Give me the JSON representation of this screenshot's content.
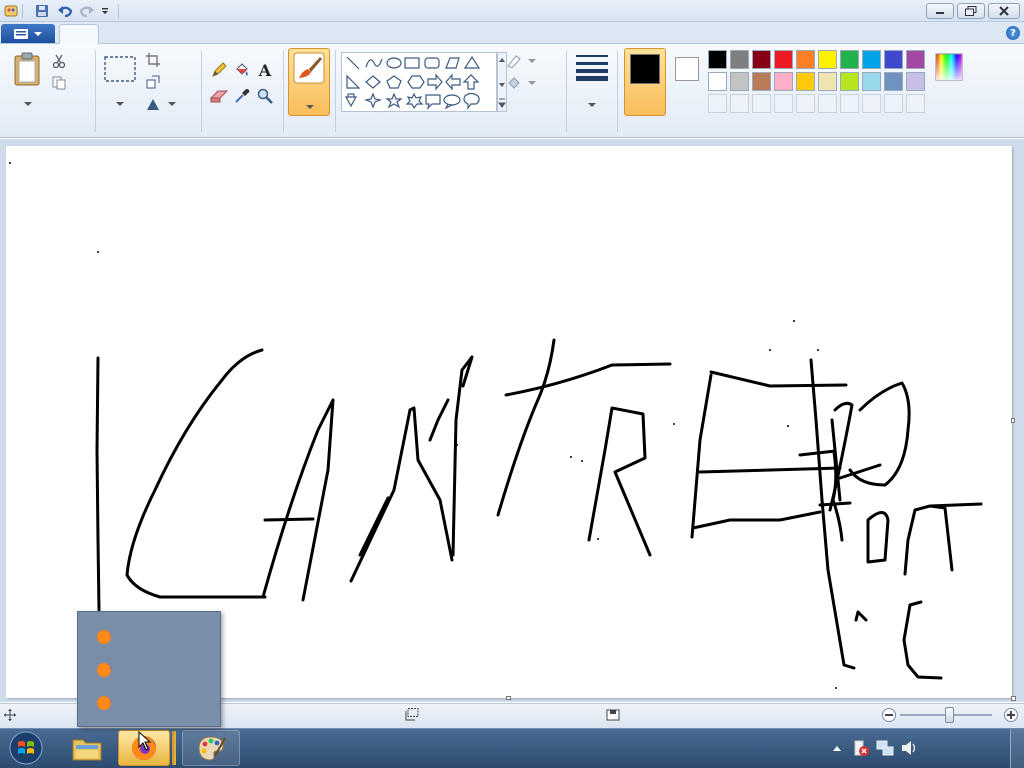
{
  "window": {
    "title": "",
    "minimize_icon": "minimize-icon",
    "restore_icon": "restore-icon",
    "close_icon": "close-icon"
  },
  "quick_access": {
    "items": [
      "paint-app-icon",
      "save-icon",
      "undo-icon",
      "redo-icon",
      "customize-arrow-icon"
    ]
  },
  "tabs": {
    "home": "",
    "view": ""
  },
  "ribbon": {
    "clipboard": {
      "group": "",
      "paste": "",
      "cut": "",
      "copy": ""
    },
    "image": {
      "group": "",
      "select": "",
      "crop": "",
      "resize": "",
      "rotate": ""
    },
    "tools": {
      "group": ""
    },
    "brushes": {
      "label": ""
    },
    "shapes": {
      "group": "",
      "outline": "",
      "fill": ""
    },
    "size": {
      "label": ""
    },
    "colors": {
      "group": "",
      "color1": "",
      "color2": "",
      "edit_colors": "",
      "color1_value": "#000000",
      "color2_value": "#ffffff",
      "palette_row1": [
        "#000000",
        "#7f7f7f",
        "#880015",
        "#ed1c24",
        "#ff7f27",
        "#fff200",
        "#22b14c",
        "#00a2e8",
        "#3f48cc",
        "#a349a4"
      ],
      "palette_row2": [
        "#ffffff",
        "#c3c3c3",
        "#b97a57",
        "#ffaec9",
        "#ffc90e",
        "#efe4b0",
        "#b5e61d",
        "#99d9ea",
        "#7092be",
        "#c8bfe7"
      ]
    }
  },
  "statusbar": {
    "selection_size": "",
    "zoom": ""
  },
  "jumplist": {
    "items": [
      "",
      "",
      ""
    ]
  },
  "taskbar": {
    "time": "",
    "date": ""
  }
}
